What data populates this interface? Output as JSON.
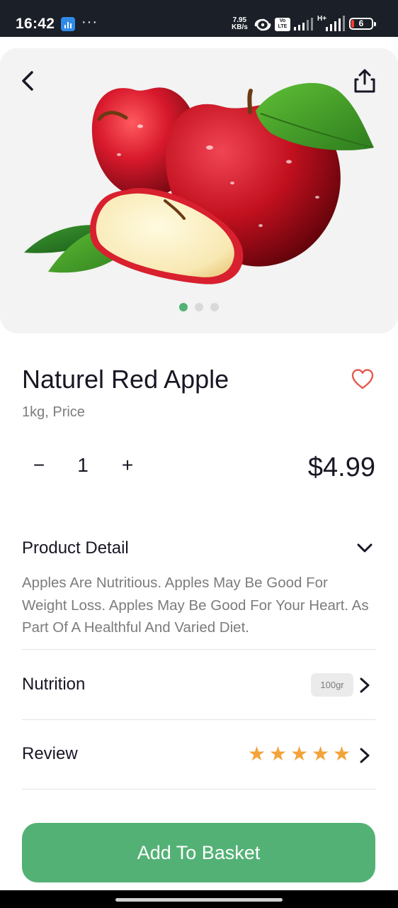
{
  "status_bar": {
    "time": "16:42",
    "dots": "···",
    "speed_value": "7.95",
    "speed_unit": "KB/s",
    "volte": "Vo LTE",
    "network_type": "H+",
    "battery": "6",
    "icons": [
      "app-notification-icon",
      "hotspot-icon",
      "volte-icon",
      "signal-icon",
      "signal-hplus-icon",
      "battery-icon"
    ]
  },
  "hero": {
    "image": "red-apples-with-leaves-image",
    "back_icon": "chevron-left-icon",
    "share_icon": "share-icon",
    "pager": {
      "count": 3,
      "active": 0
    }
  },
  "product": {
    "title": "Naturel Red Apple",
    "subtitle": "1kg, Price",
    "favorite_icon": "heart-outline-icon",
    "quantity": {
      "minus": "−",
      "value": "1",
      "plus": "+"
    },
    "price": "$4.99"
  },
  "detail": {
    "title": "Product Detail",
    "description": "Apples Are Nutritious. Apples May Be Good For Weight Loss. Apples May Be Good For Your Heart. As Part Of A Healthful And Varied Diet.",
    "toggle_icon": "chevron-down-icon"
  },
  "nutrition": {
    "title": "Nutrition",
    "badge": "100gr",
    "arrow_icon": "chevron-right-icon"
  },
  "review": {
    "title": "Review",
    "rating": 5,
    "max_rating": 5,
    "star_icon": "star-icon",
    "arrow_icon": "chevron-right-icon"
  },
  "cta": {
    "label": "Add To Basket"
  },
  "colors": {
    "accent": "#53B175",
    "star": "#F3A33A",
    "heart": "#E55B4F",
    "text_primary": "#181725",
    "text_secondary": "#7C7C7C",
    "hero_bg": "#F2F3F2"
  }
}
